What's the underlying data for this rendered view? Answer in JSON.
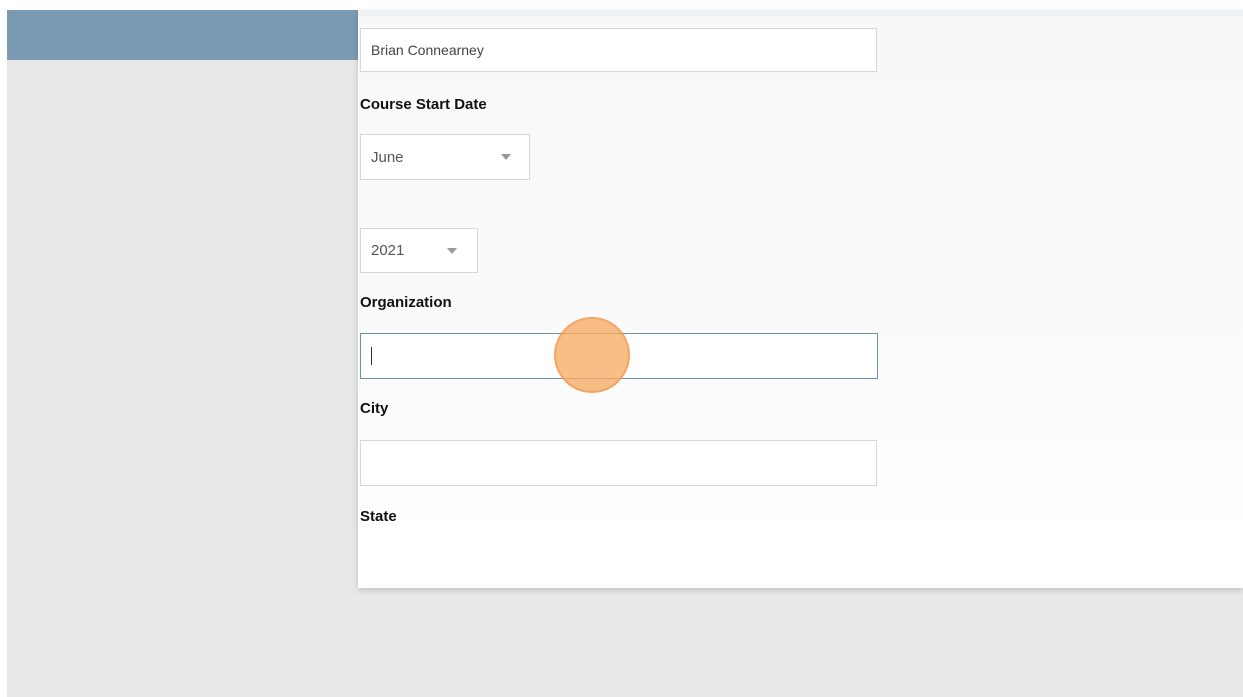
{
  "form": {
    "name_value": "Brian Connearney",
    "course_start_date_label": "Course Start Date",
    "month_selected": "June",
    "year_selected": "2021",
    "organization_label": "Organization",
    "organization_value": "",
    "city_label": "City",
    "city_value": "",
    "state_label": "State"
  },
  "icons": {
    "dropdown": "chevron-down-icon",
    "click_marker": "click-indicator"
  },
  "colors": {
    "header_band": "#7b9ab3",
    "focused_border": "#6f8fa3",
    "click_marker": "#f7aa64"
  }
}
